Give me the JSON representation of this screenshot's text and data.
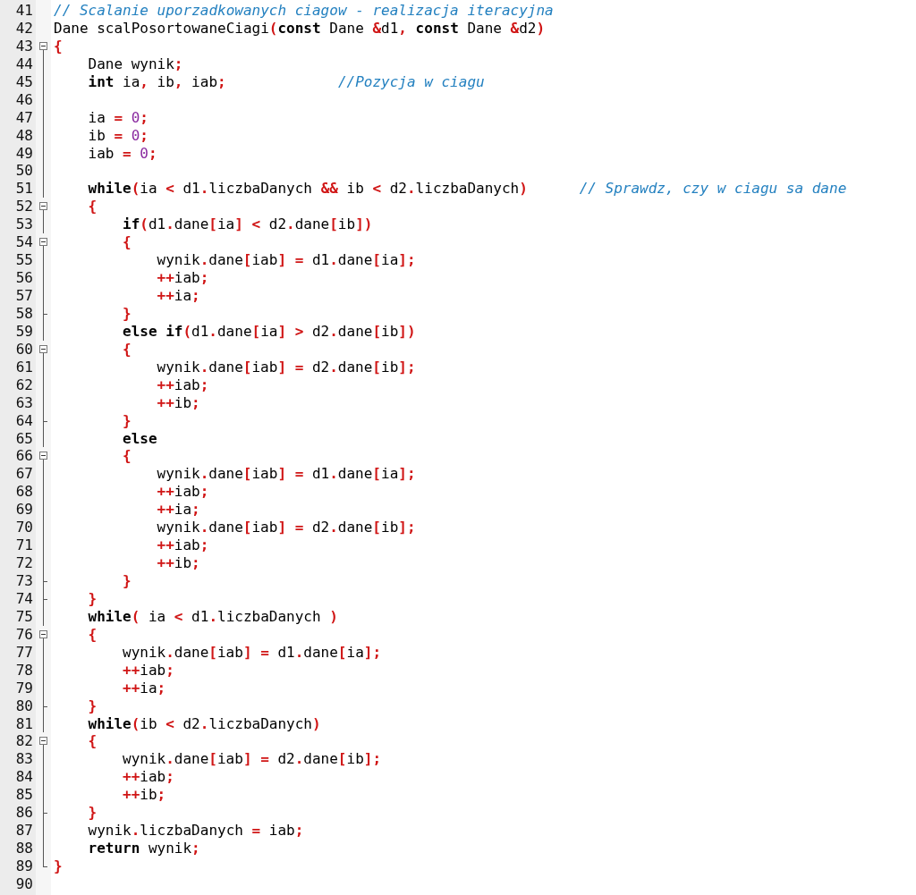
{
  "editor": {
    "lines": [
      {
        "number": "41",
        "kind": "plain",
        "tokens": [
          {
            "kind": "comment",
            "text": "// Scalanie uporzadkowanych ciagow - realizacja iteracyjna"
          }
        ]
      },
      {
        "number": "42",
        "kind": "plain",
        "tokens": [
          {
            "kind": "text",
            "text": "Dane scalPosortowaneCiagi"
          },
          {
            "kind": "op",
            "text": "("
          },
          {
            "kind": "keyword",
            "text": "const"
          },
          {
            "kind": "text",
            "text": " Dane "
          },
          {
            "kind": "op",
            "text": "&"
          },
          {
            "kind": "text",
            "text": "d1"
          },
          {
            "kind": "op",
            "text": ", "
          },
          {
            "kind": "keyword",
            "text": "const"
          },
          {
            "kind": "text",
            "text": " Dane "
          },
          {
            "kind": "op",
            "text": "&"
          },
          {
            "kind": "text",
            "text": "d2"
          },
          {
            "kind": "op",
            "text": ")"
          }
        ]
      },
      {
        "number": "43",
        "kind": "fold-start",
        "tokens": [
          {
            "kind": "op",
            "text": "{"
          }
        ],
        "children": [
          {
            "number": "44",
            "kind": "fold-line",
            "tokens": [
              {
                "kind": "text",
                "text": "Dane wynik"
              },
              {
                "kind": "op",
                "text": ";"
              }
            ]
          },
          {
            "number": "45",
            "kind": "fold-line",
            "tokens": [
              {
                "kind": "keyword",
                "text": "int"
              },
              {
                "kind": "text",
                "text": " ia"
              },
              {
                "kind": "op",
                "text": ", "
              },
              {
                "kind": "text",
                "text": "ib"
              },
              {
                "kind": "op",
                "text": ", "
              },
              {
                "kind": "text",
                "text": "iab"
              },
              {
                "kind": "op",
                "text": ";"
              },
              {
                "kind": "comment",
                "text": "             //Pozycja w ciagu"
              }
            ]
          },
          {
            "number": "46",
            "kind": "fold-line"
          },
          {
            "number": "47",
            "kind": "fold-line",
            "tokens": [
              {
                "kind": "text",
                "text": "ia "
              },
              {
                "kind": "op",
                "text": "= "
              },
              {
                "kind": "number",
                "text": "0"
              },
              {
                "kind": "op",
                "text": ";"
              }
            ]
          },
          {
            "number": "48",
            "kind": "fold-line",
            "tokens": [
              {
                "kind": "text",
                "text": "ib "
              },
              {
                "kind": "op",
                "text": "= "
              },
              {
                "kind": "number",
                "text": "0"
              },
              {
                "kind": "op",
                "text": ";"
              }
            ]
          },
          {
            "number": "49",
            "kind": "fold-line",
            "tokens": [
              {
                "kind": "text",
                "text": "iab "
              },
              {
                "kind": "op",
                "text": "= "
              },
              {
                "kind": "number",
                "text": "0"
              },
              {
                "kind": "op",
                "text": ";"
              }
            ]
          },
          {
            "number": "50",
            "kind": "fold-line"
          },
          {
            "number": "51",
            "kind": "fold-line",
            "tokens": [
              {
                "kind": "keyword",
                "text": "while"
              },
              {
                "kind": "op",
                "text": "("
              },
              {
                "kind": "text",
                "text": "ia "
              },
              {
                "kind": "op",
                "text": "< "
              },
              {
                "kind": "text",
                "text": "d1"
              },
              {
                "kind": "op",
                "text": "."
              },
              {
                "kind": "text",
                "text": "liczbaDanych "
              },
              {
                "kind": "op",
                "text": "&& "
              },
              {
                "kind": "text",
                "text": "ib "
              },
              {
                "kind": "op",
                "text": "< "
              },
              {
                "kind": "text",
                "text": "d2"
              },
              {
                "kind": "op",
                "text": "."
              },
              {
                "kind": "text",
                "text": "liczbaDanych"
              },
              {
                "kind": "op",
                "text": ")"
              },
              {
                "kind": "comment",
                "text": "      // Sprawdz, czy w ciagu sa dane"
              }
            ]
          },
          {
            "number": "52",
            "kind": "fold-start",
            "tokens": [
              {
                "kind": "op",
                "text": "{"
              }
            ],
            "children": [
              {
                "number": "53",
                "kind": "fold-line",
                "tokens": [
                  {
                    "kind": "keyword",
                    "text": "if"
                  },
                  {
                    "kind": "op",
                    "text": "("
                  },
                  {
                    "kind": "text",
                    "text": "d1"
                  },
                  {
                    "kind": "op",
                    "text": "."
                  },
                  {
                    "kind": "text",
                    "text": "dane"
                  },
                  {
                    "kind": "op",
                    "text": "["
                  },
                  {
                    "kind": "text",
                    "text": "ia"
                  },
                  {
                    "kind": "op",
                    "text": "] < "
                  },
                  {
                    "kind": "text",
                    "text": "d2"
                  },
                  {
                    "kind": "op",
                    "text": "."
                  },
                  {
                    "kind": "text",
                    "text": "dane"
                  },
                  {
                    "kind": "op",
                    "text": "["
                  },
                  {
                    "kind": "text",
                    "text": "ib"
                  },
                  {
                    "kind": "op",
                    "text": "])"
                  }
                ]
              },
              {
                "number": "54",
                "kind": "fold-start",
                "tokens": [
                  {
                    "kind": "op",
                    "text": "{"
                  }
                ],
                "children": [
                  {
                    "number": "55",
                    "kind": "fold-line",
                    "tokens": [
                      {
                        "kind": "text",
                        "text": "wynik"
                      },
                      {
                        "kind": "op",
                        "text": "."
                      },
                      {
                        "kind": "text",
                        "text": "dane"
                      },
                      {
                        "kind": "op",
                        "text": "["
                      },
                      {
                        "kind": "text",
                        "text": "iab"
                      },
                      {
                        "kind": "op",
                        "text": "] = "
                      },
                      {
                        "kind": "text",
                        "text": "d1"
                      },
                      {
                        "kind": "op",
                        "text": "."
                      },
                      {
                        "kind": "text",
                        "text": "dane"
                      },
                      {
                        "kind": "op",
                        "text": "["
                      },
                      {
                        "kind": "text",
                        "text": "ia"
                      },
                      {
                        "kind": "op",
                        "text": "];"
                      }
                    ]
                  },
                  {
                    "number": "56",
                    "kind": "fold-line",
                    "tokens": [
                      {
                        "kind": "op",
                        "text": "++"
                      },
                      {
                        "kind": "text",
                        "text": "iab"
                      },
                      {
                        "kind": "op",
                        "text": ";"
                      }
                    ]
                  },
                  {
                    "number": "57",
                    "kind": "fold-line",
                    "tokens": [
                      {
                        "kind": "op",
                        "text": "++"
                      },
                      {
                        "kind": "text",
                        "text": "ia"
                      },
                      {
                        "kind": "op",
                        "text": ";"
                      }
                    ]
                  }
                ]
              },
              {
                "number": "58",
                "kind": "fold-tick",
                "tokens": [
                  {
                    "kind": "op",
                    "text": "}"
                  }
                ]
              },
              {
                "number": "59",
                "kind": "fold-line",
                "tokens": [
                  {
                    "kind": "keyword",
                    "text": "else if"
                  },
                  {
                    "kind": "op",
                    "text": "("
                  },
                  {
                    "kind": "text",
                    "text": "d1"
                  },
                  {
                    "kind": "op",
                    "text": "."
                  },
                  {
                    "kind": "text",
                    "text": "dane"
                  },
                  {
                    "kind": "op",
                    "text": "["
                  },
                  {
                    "kind": "text",
                    "text": "ia"
                  },
                  {
                    "kind": "op",
                    "text": "] > "
                  },
                  {
                    "kind": "text",
                    "text": "d2"
                  },
                  {
                    "kind": "op",
                    "text": "."
                  },
                  {
                    "kind": "text",
                    "text": "dane"
                  },
                  {
                    "kind": "op",
                    "text": "["
                  },
                  {
                    "kind": "text",
                    "text": "ib"
                  },
                  {
                    "kind": "op",
                    "text": "])"
                  }
                ]
              },
              {
                "number": "60",
                "kind": "fold-start",
                "tokens": [
                  {
                    "kind": "op",
                    "text": "{"
                  }
                ],
                "children": [
                  {
                    "number": "61",
                    "kind": "fold-line",
                    "tokens": [
                      {
                        "kind": "text",
                        "text": "wynik"
                      },
                      {
                        "kind": "op",
                        "text": "."
                      },
                      {
                        "kind": "text",
                        "text": "dane"
                      },
                      {
                        "kind": "op",
                        "text": "["
                      },
                      {
                        "kind": "text",
                        "text": "iab"
                      },
                      {
                        "kind": "op",
                        "text": "] = "
                      },
                      {
                        "kind": "text",
                        "text": "d2"
                      },
                      {
                        "kind": "op",
                        "text": "."
                      },
                      {
                        "kind": "text",
                        "text": "dane"
                      },
                      {
                        "kind": "op",
                        "text": "["
                      },
                      {
                        "kind": "text",
                        "text": "ib"
                      },
                      {
                        "kind": "op",
                        "text": "];"
                      }
                    ]
                  },
                  {
                    "number": "62",
                    "kind": "fold-line",
                    "tokens": [
                      {
                        "kind": "op",
                        "text": "++"
                      },
                      {
                        "kind": "text",
                        "text": "iab"
                      },
                      {
                        "kind": "op",
                        "text": ";"
                      }
                    ]
                  },
                  {
                    "number": "63",
                    "kind": "fold-line",
                    "tokens": [
                      {
                        "kind": "op",
                        "text": "++"
                      },
                      {
                        "kind": "text",
                        "text": "ib"
                      },
                      {
                        "kind": "op",
                        "text": ";"
                      }
                    ]
                  }
                ]
              },
              {
                "number": "64",
                "kind": "fold-tick",
                "tokens": [
                  {
                    "kind": "op",
                    "text": "}"
                  }
                ]
              },
              {
                "number": "65",
                "kind": "fold-line",
                "tokens": [
                  {
                    "kind": "keyword",
                    "text": "else"
                  }
                ]
              },
              {
                "number": "66",
                "kind": "fold-start",
                "tokens": [
                  {
                    "kind": "op",
                    "text": "{"
                  }
                ],
                "children": [
                  {
                    "number": "67",
                    "kind": "fold-line",
                    "tokens": [
                      {
                        "kind": "text",
                        "text": "wynik"
                      },
                      {
                        "kind": "op",
                        "text": "."
                      },
                      {
                        "kind": "text",
                        "text": "dane"
                      },
                      {
                        "kind": "op",
                        "text": "["
                      },
                      {
                        "kind": "text",
                        "text": "iab"
                      },
                      {
                        "kind": "op",
                        "text": "] = "
                      },
                      {
                        "kind": "text",
                        "text": "d1"
                      },
                      {
                        "kind": "op",
                        "text": "."
                      },
                      {
                        "kind": "text",
                        "text": "dane"
                      },
                      {
                        "kind": "op",
                        "text": "["
                      },
                      {
                        "kind": "text",
                        "text": "ia"
                      },
                      {
                        "kind": "op",
                        "text": "];"
                      }
                    ]
                  },
                  {
                    "number": "68",
                    "kind": "fold-line",
                    "tokens": [
                      {
                        "kind": "op",
                        "text": "++"
                      },
                      {
                        "kind": "text",
                        "text": "iab"
                      },
                      {
                        "kind": "op",
                        "text": ";"
                      }
                    ]
                  },
                  {
                    "number": "69",
                    "kind": "fold-line",
                    "tokens": [
                      {
                        "kind": "op",
                        "text": "++"
                      },
                      {
                        "kind": "text",
                        "text": "ia"
                      },
                      {
                        "kind": "op",
                        "text": ";"
                      }
                    ]
                  },
                  {
                    "number": "70",
                    "kind": "fold-line",
                    "tokens": [
                      {
                        "kind": "text",
                        "text": "wynik"
                      },
                      {
                        "kind": "op",
                        "text": "."
                      },
                      {
                        "kind": "text",
                        "text": "dane"
                      },
                      {
                        "kind": "op",
                        "text": "["
                      },
                      {
                        "kind": "text",
                        "text": "iab"
                      },
                      {
                        "kind": "op",
                        "text": "] = "
                      },
                      {
                        "kind": "text",
                        "text": "d2"
                      },
                      {
                        "kind": "op",
                        "text": "."
                      },
                      {
                        "kind": "text",
                        "text": "dane"
                      },
                      {
                        "kind": "op",
                        "text": "["
                      },
                      {
                        "kind": "text",
                        "text": "ib"
                      },
                      {
                        "kind": "op",
                        "text": "];"
                      }
                    ]
                  },
                  {
                    "number": "71",
                    "kind": "fold-line",
                    "tokens": [
                      {
                        "kind": "op",
                        "text": "++"
                      },
                      {
                        "kind": "text",
                        "text": "iab"
                      },
                      {
                        "kind": "op",
                        "text": ";"
                      }
                    ]
                  },
                  {
                    "number": "72",
                    "kind": "fold-line",
                    "tokens": [
                      {
                        "kind": "op",
                        "text": "++"
                      },
                      {
                        "kind": "text",
                        "text": "ib"
                      },
                      {
                        "kind": "op",
                        "text": ";"
                      }
                    ]
                  }
                ]
              },
              {
                "number": "73",
                "kind": "fold-tick",
                "tokens": [
                  {
                    "kind": "op",
                    "text": "}"
                  }
                ]
              }
            ]
          },
          {
            "number": "74",
            "kind": "fold-tick",
            "tokens": [
              {
                "kind": "op",
                "text": "}"
              }
            ]
          },
          {
            "number": "75",
            "kind": "fold-line",
            "tokens": [
              {
                "kind": "keyword",
                "text": "while"
              },
              {
                "kind": "op",
                "text": "( "
              },
              {
                "kind": "text",
                "text": "ia "
              },
              {
                "kind": "op",
                "text": "< "
              },
              {
                "kind": "text",
                "text": "d1"
              },
              {
                "kind": "op",
                "text": "."
              },
              {
                "kind": "text",
                "text": "liczbaDanych "
              },
              {
                "kind": "op",
                "text": ")"
              }
            ]
          },
          {
            "number": "76",
            "kind": "fold-start",
            "tokens": [
              {
                "kind": "op",
                "text": "{"
              }
            ],
            "children": [
              {
                "number": "77",
                "kind": "fold-line",
                "tokens": [
                  {
                    "kind": "text",
                    "text": "wynik"
                  },
                  {
                    "kind": "op",
                    "text": "."
                  },
                  {
                    "kind": "text",
                    "text": "dane"
                  },
                  {
                    "kind": "op",
                    "text": "["
                  },
                  {
                    "kind": "text",
                    "text": "iab"
                  },
                  {
                    "kind": "op",
                    "text": "] = "
                  },
                  {
                    "kind": "text",
                    "text": "d1"
                  },
                  {
                    "kind": "op",
                    "text": "."
                  },
                  {
                    "kind": "text",
                    "text": "dane"
                  },
                  {
                    "kind": "op",
                    "text": "["
                  },
                  {
                    "kind": "text",
                    "text": "ia"
                  },
                  {
                    "kind": "op",
                    "text": "];"
                  }
                ]
              },
              {
                "number": "78",
                "kind": "fold-line",
                "tokens": [
                  {
                    "kind": "op",
                    "text": "++"
                  },
                  {
                    "kind": "text",
                    "text": "iab"
                  },
                  {
                    "kind": "op",
                    "text": ";"
                  }
                ]
              },
              {
                "number": "79",
                "kind": "fold-line",
                "tokens": [
                  {
                    "kind": "op",
                    "text": "++"
                  },
                  {
                    "kind": "text",
                    "text": "ia"
                  },
                  {
                    "kind": "op",
                    "text": ";"
                  }
                ]
              }
            ]
          },
          {
            "number": "80",
            "kind": "fold-tick",
            "tokens": [
              {
                "kind": "op",
                "text": "}"
              }
            ]
          },
          {
            "number": "81",
            "kind": "fold-line",
            "tokens": [
              {
                "kind": "keyword",
                "text": "while"
              },
              {
                "kind": "op",
                "text": "("
              },
              {
                "kind": "text",
                "text": "ib "
              },
              {
                "kind": "op",
                "text": "< "
              },
              {
                "kind": "text",
                "text": "d2"
              },
              {
                "kind": "op",
                "text": "."
              },
              {
                "kind": "text",
                "text": "liczbaDanych"
              },
              {
                "kind": "op",
                "text": ")"
              }
            ]
          },
          {
            "number": "82",
            "kind": "fold-start",
            "tokens": [
              {
                "kind": "op",
                "text": "{"
              }
            ],
            "children": [
              {
                "number": "83",
                "kind": "fold-line",
                "tokens": [
                  {
                    "kind": "text",
                    "text": "wynik"
                  },
                  {
                    "kind": "op",
                    "text": "."
                  },
                  {
                    "kind": "text",
                    "text": "dane"
                  },
                  {
                    "kind": "op",
                    "text": "["
                  },
                  {
                    "kind": "text",
                    "text": "iab"
                  },
                  {
                    "kind": "op",
                    "text": "] = "
                  },
                  {
                    "kind": "text",
                    "text": "d2"
                  },
                  {
                    "kind": "op",
                    "text": "."
                  },
                  {
                    "kind": "text",
                    "text": "dane"
                  },
                  {
                    "kind": "op",
                    "text": "["
                  },
                  {
                    "kind": "text",
                    "text": "ib"
                  },
                  {
                    "kind": "op",
                    "text": "];"
                  }
                ]
              },
              {
                "number": "84",
                "kind": "fold-line",
                "tokens": [
                  {
                    "kind": "op",
                    "text": "++"
                  },
                  {
                    "kind": "text",
                    "text": "iab"
                  },
                  {
                    "kind": "op",
                    "text": ";"
                  }
                ]
              },
              {
                "number": "85",
                "kind": "fold-line",
                "tokens": [
                  {
                    "kind": "op",
                    "text": "++"
                  },
                  {
                    "kind": "text",
                    "text": "ib"
                  },
                  {
                    "kind": "op",
                    "text": ";"
                  }
                ]
              }
            ]
          },
          {
            "number": "86",
            "kind": "fold-tick",
            "tokens": [
              {
                "kind": "op",
                "text": "}"
              }
            ]
          },
          {
            "number": "87",
            "kind": "fold-line",
            "tokens": [
              {
                "kind": "text",
                "text": "wynik"
              },
              {
                "kind": "op",
                "text": "."
              },
              {
                "kind": "text",
                "text": "liczbaDanych "
              },
              {
                "kind": "op",
                "text": "= "
              },
              {
                "kind": "text",
                "text": "iab"
              },
              {
                "kind": "op",
                "text": ";"
              }
            ]
          },
          {
            "number": "88",
            "kind": "fold-line",
            "tokens": [
              {
                "kind": "keyword",
                "text": "return"
              },
              {
                "kind": "text",
                "text": " wynik"
              },
              {
                "kind": "op",
                "text": ";"
              }
            ]
          }
        ]
      },
      {
        "number": "89",
        "kind": "fold-end",
        "tokens": [
          {
            "kind": "op",
            "text": "}"
          }
        ]
      },
      {
        "number": "90",
        "kind": "plain"
      }
    ]
  }
}
